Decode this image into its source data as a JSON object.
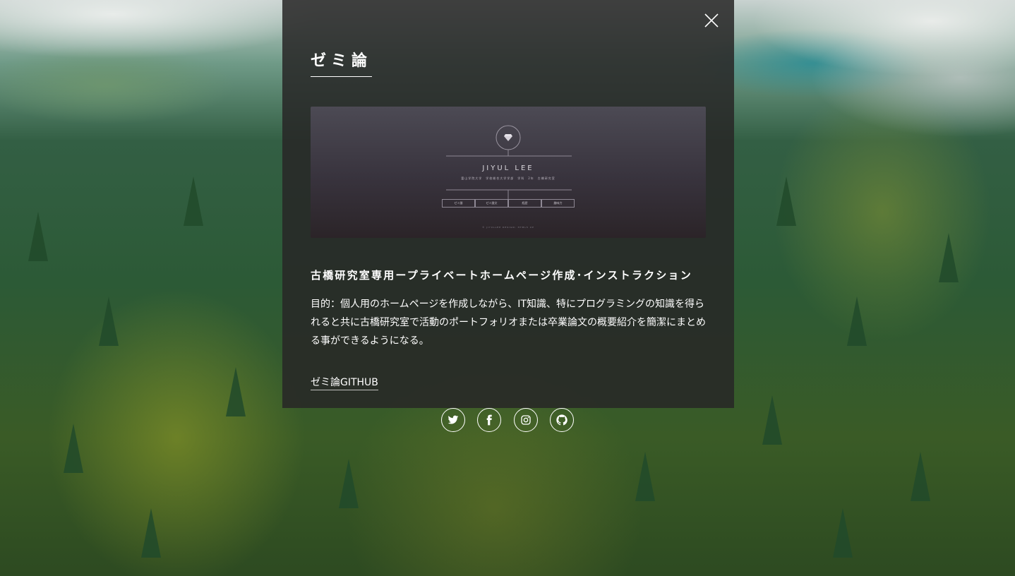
{
  "modal": {
    "title": "ゼミ論",
    "close_icon": "close-icon",
    "preview": {
      "name": "JIYUL LEE",
      "subtitle": "富山学院大学　学校総合大学学部　学科　2年　古橋研究室",
      "buttons": [
        "ゼミ論",
        "ゼミ論文",
        "経歴",
        "趣味力"
      ],
      "footer": "© JIYULLEE DESIGN: HTML5 UP",
      "logo_icon": "diamond-icon"
    },
    "project_title": "古橋研究室専用ープライベートホームページ作成･インストラクション",
    "description": "目的：個人用のホームページを作成しながら、IT知識、特にプログラミングの知識を得られると共に古橋研究室で活動のポートフォリオまたは卒業論文の概要紹介を簡潔にまとめる事ができるようになる。",
    "github_link": "ゼミ論GITHUB"
  },
  "social": [
    {
      "icon": "twitter-icon"
    },
    {
      "icon": "facebook-icon"
    },
    {
      "icon": "instagram-icon"
    },
    {
      "icon": "github-icon"
    }
  ],
  "colors": {
    "modal_bg": "#282626",
    "text": "#ffffff"
  }
}
